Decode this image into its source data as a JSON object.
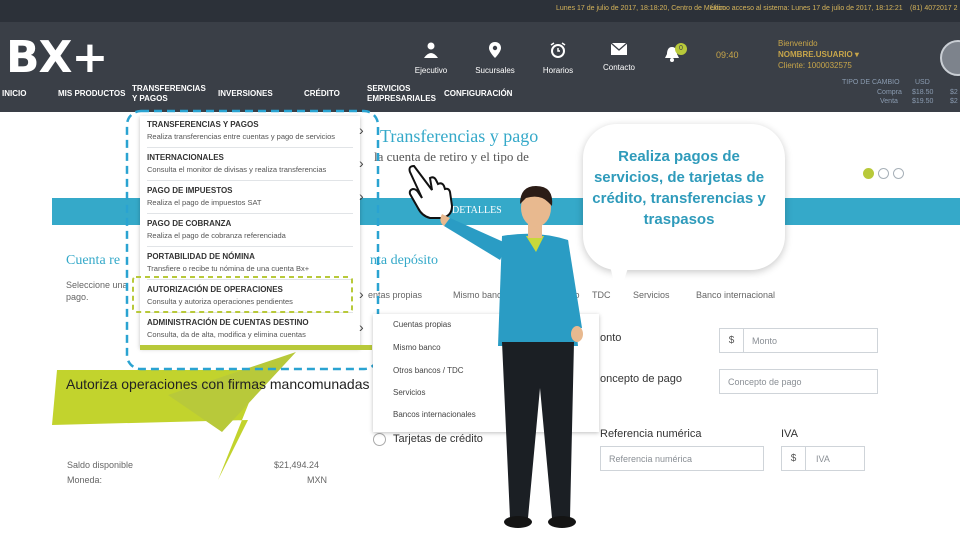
{
  "topbar": {
    "datetime": "Lunes 17 de julio de 2017, 18:18:20, Centro de México",
    "last_access": "Último acceso al sistema: Lunes 17 de julio de 2017, 18:12:21",
    "phone": "(81) 4072017 2"
  },
  "header": {
    "logo": "BX+",
    "icons": [
      {
        "name": "ejecutivo-icon",
        "label": "Ejecutivo"
      },
      {
        "name": "sucursales-icon",
        "label": "Sucursales"
      },
      {
        "name": "horarios-icon",
        "label": "Horarios"
      },
      {
        "name": "contacto-icon",
        "label": "Contacto"
      }
    ],
    "notifications_count": "0",
    "time": "09:40",
    "welcome": "Bienvenido",
    "username": "NOMBRE.USUARIO",
    "client": "Cliente: 1000032575"
  },
  "nav": {
    "items": [
      "INICIO",
      "MIS PRODUCTOS",
      "TRANSFERENCIAS Y PAGOS",
      "INVERSIONES",
      "CRÉDITO",
      "SERVICIOS EMPRESARIALES",
      "CONFIGURACIÓN"
    ]
  },
  "rates": {
    "label": "TIPO DE CAMBIO",
    "col2": "USD",
    "buy_label": "Compra",
    "sell_label": "Venta",
    "buy": "$18.50",
    "sell": "$19.50",
    "extra_buy": "$2",
    "extra_sell": "$2"
  },
  "page": {
    "title": "Transferencias y pago",
    "subtitle": "la cuenta de retiro y el tipo de",
    "details_button": "DETALLES",
    "section_left": "Cuenta re",
    "section_right": "nta depósito",
    "left_desc_1": "Seleccione una",
    "left_desc_2": "pago.",
    "tabs": [
      "entas propias",
      "Mismo banco",
      "anco",
      "TDC",
      "Servicios",
      "Banco internacional"
    ],
    "monto_label": "onto",
    "monto_placeholder": "Monto",
    "concepto_label": "oncepto de pago",
    "concepto_placeholder": "Concepto de pago",
    "tarjetas_label": "Tarjetas de crédito",
    "referencia_label": "Referencia numérica",
    "referencia_placeholder": "Referencia numérica",
    "iva_label": "IVA",
    "iva_placeholder": "IVA",
    "currency_symbol": "$",
    "saldo_label": "Saldo disponible",
    "saldo_value": "$21,494.24",
    "moneda_label": "Moneda:",
    "moneda_value": "MXN"
  },
  "menu": {
    "items": [
      {
        "title": "TRANSFERENCIAS Y PAGOS",
        "desc": "Realiza transferencias entre cuentas y pago de servicios"
      },
      {
        "title": "INTERNACIONALES",
        "desc": "Consulta el monitor de divisas y realiza transferencias"
      },
      {
        "title": "PAGO DE IMPUESTOS",
        "desc": "Realiza el pago de impuestos SAT"
      },
      {
        "title": "PAGO DE COBRANZA",
        "desc": "Realiza el pago de cobranza referenciada"
      },
      {
        "title": "PORTABILIDAD DE NÓMINA",
        "desc": "Transfiere o recibe tu nómina de una cuenta Bx+"
      },
      {
        "title": "AUTORIZACIÓN DE OPERACIONES",
        "desc": "Consulta y autoriza operaciones pendientes"
      },
      {
        "title": "ADMINISTRACIÓN DE CUENTAS DESTINO",
        "desc": "Consulta, da de alta, modifica y elimina cuentas"
      }
    ]
  },
  "submenu": {
    "items": [
      "Cuentas propias",
      "Mismo banco",
      "Otros bancos / TDC",
      "Servicios",
      "Bancos internacionales"
    ]
  },
  "callouts": {
    "bubble": "Realiza pagos de servicios, de tarjetas de crédito, transferencias y traspasos",
    "bottom": "Autoriza operaciones con firmas mancomunadas"
  },
  "colors": {
    "accent_teal": "#35a9c9",
    "accent_lime": "#b8c93a",
    "header_dark": "#3a3f47",
    "gold": "#c8a64a"
  }
}
